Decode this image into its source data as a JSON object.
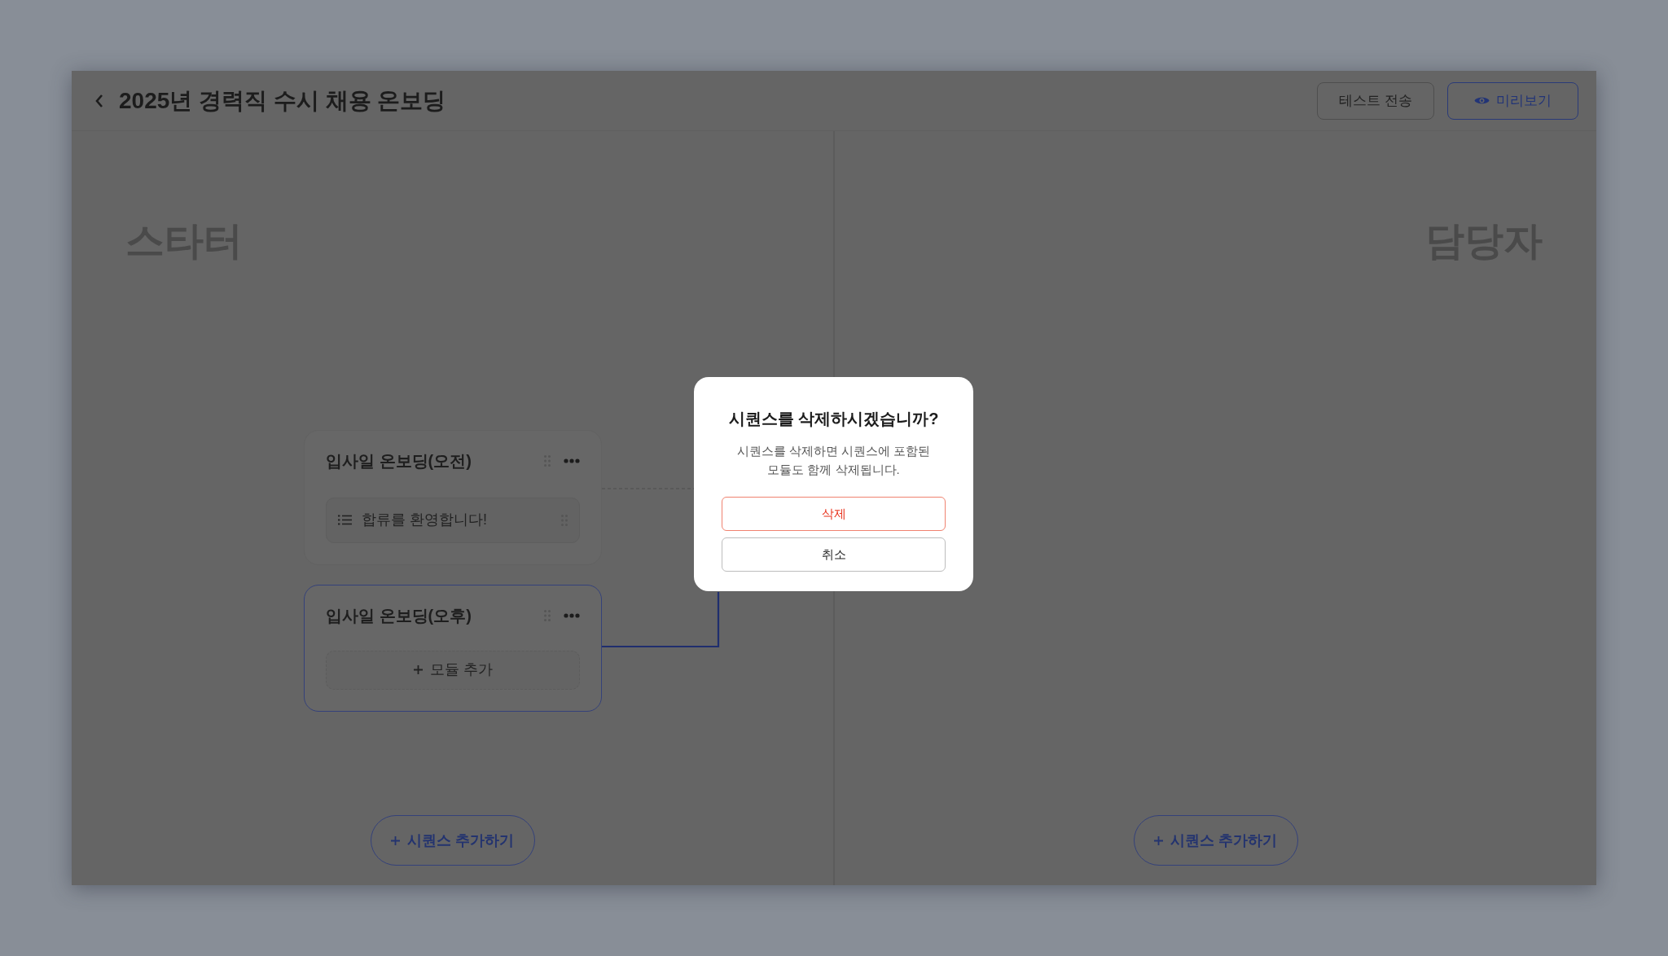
{
  "header": {
    "title": "2025년 경력직 수시 채용 온보딩",
    "buttons": [
      {
        "label": "테스트 전송",
        "kind": "plain"
      },
      {
        "label": "미리보기",
        "kind": "preview"
      }
    ]
  },
  "lanes": [
    {
      "title": "스타터",
      "add_button": "시퀀스 추가하기",
      "sequences": [
        {
          "title": "입사일 온보딩(오전)",
          "selected": false,
          "modules": [
            {
              "kind": "module",
              "label": "합류를 환영합니다!"
            }
          ]
        },
        {
          "title": "입사일 온보딩(오후)",
          "selected": true,
          "modules": [
            {
              "kind": "add",
              "label": "모듈 추가"
            }
          ]
        }
      ]
    },
    {
      "title": "담당자",
      "add_button": "시퀀스 추가하기"
    }
  ],
  "dialog": {
    "title": "시퀀스를 삭제하시겠습니까?",
    "message": "시퀀스를 삭제하면 시퀀스에 포함된\n모듈도 함께 삭제됩니다.",
    "buttons": [
      {
        "label": "삭제",
        "kind": "danger"
      },
      {
        "label": "취소",
        "kind": "cancel"
      }
    ]
  }
}
